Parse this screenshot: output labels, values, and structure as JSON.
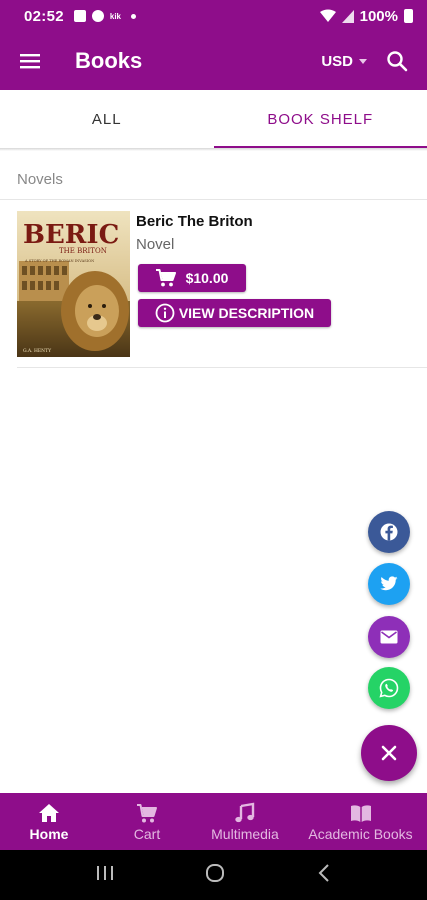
{
  "status_bar": {
    "time": "02:52",
    "notif_text": "kik",
    "battery": "100%"
  },
  "app_bar": {
    "title": "Books",
    "currency": "USD"
  },
  "tabs": [
    {
      "label": "ALL",
      "active": false
    },
    {
      "label": "BOOK SHELF",
      "active": true
    }
  ],
  "section": {
    "header": "Novels"
  },
  "books": [
    {
      "title": "Beric The Briton",
      "category": "Novel",
      "price": "$10.00",
      "description_label": "VIEW DESCRIPTION",
      "cover": {
        "title_big": "BERIC",
        "title_small": "THE BRITON",
        "tagline": "A STORY OF THE ROMAN INVASION",
        "author": "G.A. HENTY"
      }
    }
  ],
  "share_fabs": [
    "facebook-icon",
    "twitter-icon",
    "mail-icon",
    "whatsapp-icon"
  ],
  "bottom_nav": [
    {
      "label": "Home",
      "icon": "home-icon",
      "active": true
    },
    {
      "label": "Cart",
      "icon": "cart-icon",
      "active": false
    },
    {
      "label": "Multimedia",
      "icon": "music-note-icon",
      "active": false
    },
    {
      "label": "Academic Books",
      "icon": "book-open-icon",
      "active": false
    }
  ],
  "colors": {
    "primary": "#8e0d8a",
    "facebook": "#3b5998",
    "twitter": "#1da1f2",
    "mail": "#8e2fb8",
    "whatsapp": "#25d366"
  }
}
